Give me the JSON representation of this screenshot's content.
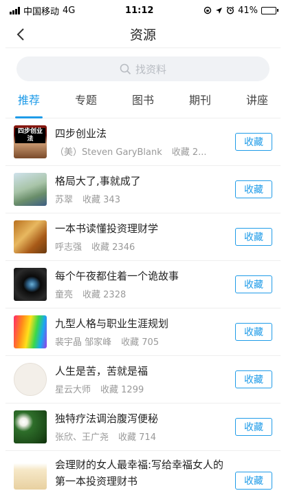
{
  "status_bar": {
    "carrier": "中国移动",
    "network": "4G",
    "time": "11:12",
    "battery_text": "41%",
    "battery_level": 0.41
  },
  "nav": {
    "title": "资源",
    "back_icon": "chevron-left-icon"
  },
  "search": {
    "placeholder": "找资料",
    "icon": "search-icon"
  },
  "tabs": [
    {
      "label": "推荐",
      "active": true
    },
    {
      "label": "专题",
      "active": false
    },
    {
      "label": "图书",
      "active": false
    },
    {
      "label": "期刊",
      "active": false
    },
    {
      "label": "讲座",
      "active": false
    }
  ],
  "items": [
    {
      "title": "四步创业法",
      "thumb_text": "四步创业法",
      "author": "（美）Steven GaryBlank",
      "favorites": "收藏 2...",
      "button": "收藏"
    },
    {
      "title": "格局大了,事就成了",
      "author": "苏翠",
      "favorites": "收藏 343",
      "button": "收藏"
    },
    {
      "title": "一本书读懂投资理财学",
      "author": "呼志强",
      "favorites": "收藏 2346",
      "button": "收藏"
    },
    {
      "title": "每个午夜都住着一个诡故事",
      "author": "童亮",
      "favorites": "收藏 2328",
      "button": "收藏"
    },
    {
      "title": "九型人格与职业生涯规划",
      "author": "裴宇晶 邹家峰",
      "favorites": "收藏 705",
      "button": "收藏"
    },
    {
      "title": "人生是苦，苦就是福",
      "author": "星云大师",
      "favorites": "收藏 1299",
      "button": "收藏"
    },
    {
      "title": "独特疗法调治腹泻便秘",
      "author": "张欣、王广尧",
      "favorites": "收藏 714",
      "button": "收藏"
    },
    {
      "title": "会理财的女人最幸福:写给幸福女人的第一本投资理财书",
      "author": "",
      "favorites": "",
      "button": "收藏"
    }
  ],
  "colors": {
    "accent": "#1e9be8",
    "text_primary": "#222222",
    "text_secondary": "#999999",
    "search_bg": "#f0f2f5"
  }
}
